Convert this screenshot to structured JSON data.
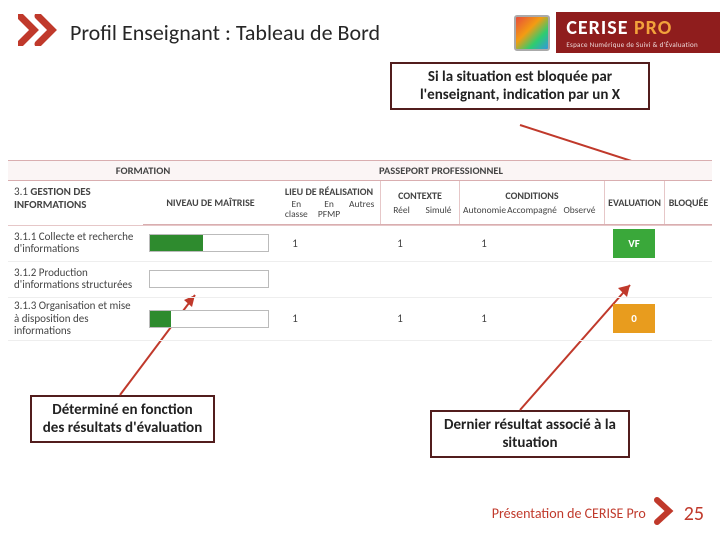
{
  "header": {
    "title": "Profil Enseignant : Tableau de Bord",
    "brand_name_a": "CERISE",
    "brand_name_b": " PRO",
    "brand_sub": "Espace Numérique de Suivi & d'Évaluation"
  },
  "callouts": {
    "top": "Si la situation est bloquée par l'enseignant,\nindication par un X",
    "left": "Déterminé en fonction des résultats d'évaluation",
    "right": "Dernier résultat associé à la situation"
  },
  "table": {
    "group_formation": "FORMATION",
    "group_passport": "PASSEPORT PROFESSIONNEL",
    "col_niveau": "NIVEAU DE MAÎTRISE",
    "grp_lieu": "LIEU DE RÉALISATION",
    "lieu_en": "En classe",
    "lieu_pfmp": "En PFMP",
    "lieu_autres": "Autres",
    "grp_ctx": "CONTEXTE",
    "ctx_reel": "Réel",
    "ctx_sim": "Simulé",
    "grp_cond": "CONDITIONS",
    "cond_auto": "Autonomie",
    "cond_acc": "Accompagné",
    "cond_obs": "Observé",
    "col_eval": "EVALUATION",
    "col_bloq": "BLOQUÉE",
    "section_code": "3.1 ",
    "section_name": "GESTION DES INFORMATIONS",
    "rows": [
      {
        "label": "3.1.1 Collecte et recherche d'informations",
        "bar_pct": 45,
        "en": "1",
        "reel": "1",
        "auto": "1",
        "eval": "VF",
        "eval_class": "eval-green"
      },
      {
        "label": "3.1.2 Production d'informations structurées",
        "bar_pct": 0,
        "en": "",
        "reel": "",
        "auto": "",
        "eval": "",
        "eval_class": ""
      },
      {
        "label": "3.1.3 Organisation et mise à disposition des informations",
        "bar_pct": 18,
        "en": "1",
        "reel": "1",
        "auto": "1",
        "eval": "0",
        "eval_class": "eval-orange"
      }
    ]
  },
  "footer": {
    "text": "Présentation de CERISE Pro",
    "page": "25"
  },
  "colors": {
    "accent": "#c0392b",
    "callout_border": "#521d1d",
    "bar_green": "#2e8b2e",
    "badge_green": "#3aa83a",
    "badge_orange": "#e89c1e"
  }
}
